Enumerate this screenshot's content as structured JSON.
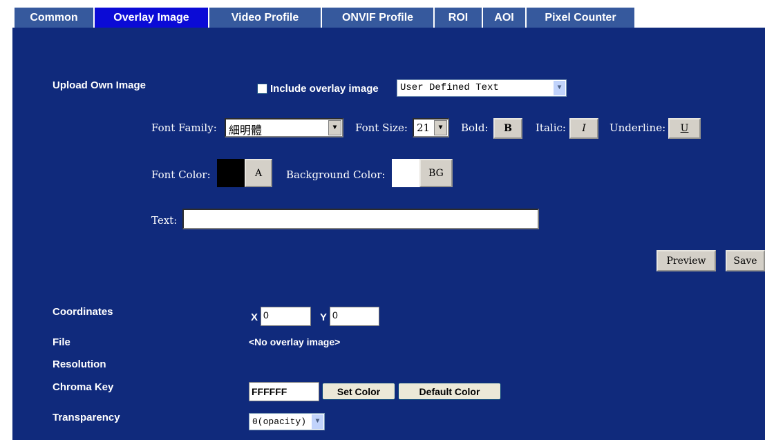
{
  "tabs": [
    {
      "label": "Common"
    },
    {
      "label": "Overlay Image"
    },
    {
      "label": "Video Profile"
    },
    {
      "label": "ONVIF Profile"
    },
    {
      "label": "ROI"
    },
    {
      "label": "AOI"
    },
    {
      "label": "Pixel Counter"
    }
  ],
  "active_tab": "Overlay Image",
  "upload": {
    "label": "Upload Own Image",
    "include_label": "Include overlay image",
    "include_checked": false,
    "mode_value": "User Defined Text"
  },
  "font": {
    "family_label": "Font Family:",
    "family_value": "細明體",
    "size_label": "Font Size:",
    "size_value": "21",
    "bold_label": "Bold:",
    "bold_button": "B",
    "italic_label": "Italic:",
    "italic_button": "I",
    "underline_label": "Underline:",
    "underline_button": "U",
    "color_label": "Font Color:",
    "color_button": "A",
    "font_color": "#000000",
    "bg_label": "Background Color:",
    "bg_button": "BG",
    "bg_color": "#ffffff"
  },
  "text": {
    "label": "Text:",
    "value": ""
  },
  "actions": {
    "preview": "Preview",
    "save": "Save"
  },
  "coordinates": {
    "label": "Coordinates",
    "x_label": "X",
    "x_value": "0",
    "y_label": "Y",
    "y_value": "0"
  },
  "file": {
    "label": "File",
    "value": "<No overlay image>"
  },
  "resolution": {
    "label": "Resolution",
    "value": ""
  },
  "chroma": {
    "label": "Chroma Key",
    "value": "FFFFFF",
    "set_color": "Set Color",
    "default_color": "Default Color"
  },
  "transparency": {
    "label": "Transparency",
    "value": "0(opacity)"
  },
  "colors": {
    "panel": "#102a7c",
    "tab": "#36599d",
    "tab_active": "#0b0bd6"
  }
}
